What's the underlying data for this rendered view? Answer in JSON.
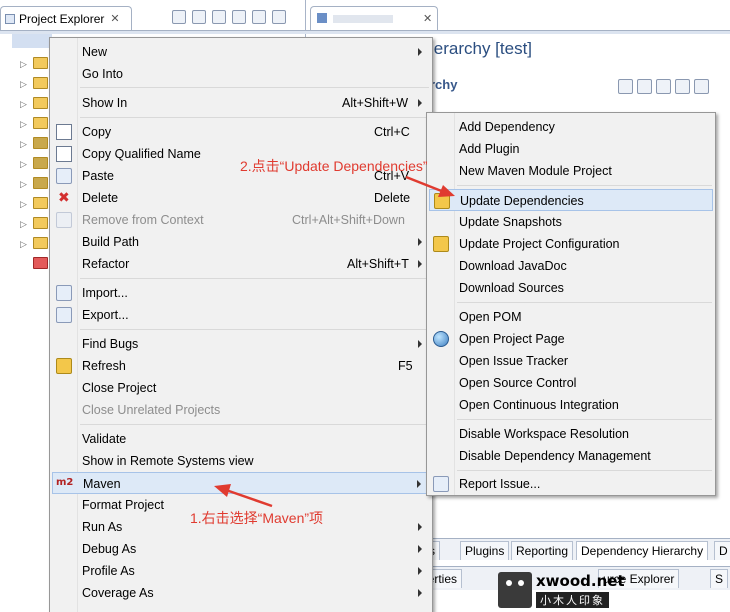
{
  "project_explorer": {
    "title": "Project Explorer"
  },
  "editor": {
    "title": "ierarchy [test]",
    "section": "rchy"
  },
  "context_menu": {
    "items": [
      {
        "label": "New",
        "shortcut": "",
        "submenu": true,
        "disabled": false
      },
      {
        "label": "Go Into",
        "shortcut": "",
        "submenu": false,
        "disabled": false
      },
      {
        "label": "Show In",
        "shortcut": "Alt+Shift+W",
        "submenu": true,
        "disabled": false
      },
      {
        "label": "Copy",
        "shortcut": "Ctrl+C",
        "submenu": false,
        "disabled": false
      },
      {
        "label": "Copy Qualified Name",
        "shortcut": "",
        "submenu": false,
        "disabled": false
      },
      {
        "label": "Paste",
        "shortcut": "Ctrl+V",
        "submenu": false,
        "disabled": false
      },
      {
        "label": "Delete",
        "shortcut": "Delete",
        "submenu": false,
        "disabled": false
      },
      {
        "label": "Remove from Context",
        "shortcut": "Ctrl+Alt+Shift+Down",
        "submenu": false,
        "disabled": true
      },
      {
        "label": "Build Path",
        "shortcut": "",
        "submenu": true,
        "disabled": false
      },
      {
        "label": "Refactor",
        "shortcut": "Alt+Shift+T",
        "submenu": true,
        "disabled": false
      },
      {
        "label": "Import...",
        "shortcut": "",
        "submenu": false,
        "disabled": false
      },
      {
        "label": "Export...",
        "shortcut": "",
        "submenu": false,
        "disabled": false
      },
      {
        "label": "Find Bugs",
        "shortcut": "",
        "submenu": true,
        "disabled": false
      },
      {
        "label": "Refresh",
        "shortcut": "F5",
        "submenu": false,
        "disabled": false
      },
      {
        "label": "Close Project",
        "shortcut": "",
        "submenu": false,
        "disabled": false
      },
      {
        "label": "Close Unrelated Projects",
        "shortcut": "",
        "submenu": false,
        "disabled": true
      },
      {
        "label": "Validate",
        "shortcut": "",
        "submenu": false,
        "disabled": false
      },
      {
        "label": "Show in Remote Systems view",
        "shortcut": "",
        "submenu": false,
        "disabled": false
      },
      {
        "label": "Maven",
        "shortcut": "",
        "submenu": true,
        "disabled": false,
        "icon_text": "m2"
      },
      {
        "label": "Format Project",
        "shortcut": "",
        "submenu": false,
        "disabled": false
      },
      {
        "label": "Run As",
        "shortcut": "",
        "submenu": true,
        "disabled": false
      },
      {
        "label": "Debug As",
        "shortcut": "",
        "submenu": true,
        "disabled": false
      },
      {
        "label": "Profile As",
        "shortcut": "",
        "submenu": true,
        "disabled": false
      },
      {
        "label": "Coverage As",
        "shortcut": "",
        "submenu": true,
        "disabled": false
      }
    ]
  },
  "maven_submenu": {
    "items": [
      {
        "label": "Add Dependency"
      },
      {
        "label": "Add Plugin"
      },
      {
        "label": "New Maven Module Project"
      },
      {
        "label": "Update Dependencies"
      },
      {
        "label": "Update Snapshots"
      },
      {
        "label": "Update Project Configuration"
      },
      {
        "label": "Download JavaDoc"
      },
      {
        "label": "Download Sources"
      },
      {
        "label": "Open POM"
      },
      {
        "label": "Open Project Page"
      },
      {
        "label": "Open Issue Tracker"
      },
      {
        "label": "Open Source Control"
      },
      {
        "label": "Open Continuous Integration"
      },
      {
        "label": "Disable Workspace Resolution"
      },
      {
        "label": "Disable Dependency Management"
      },
      {
        "label": "Report Issue..."
      }
    ]
  },
  "bottom_tabs": [
    "ncies",
    "Plugins",
    "Reporting",
    "Dependency Hierarchy",
    "D"
  ],
  "bottom_tabs2": [
    "perties",
    "urce Explorer",
    "S"
  ],
  "annotations": {
    "step1": "1.右击选择“Maven”项",
    "step2": "2.点击“Update Dependencies”"
  },
  "watermark": {
    "brand": "xwood.net",
    "sub": "小木人印象"
  },
  "colors": {
    "annotation": "#e03b30",
    "highlight": "#dde9f7",
    "title": "#2b4e80"
  }
}
